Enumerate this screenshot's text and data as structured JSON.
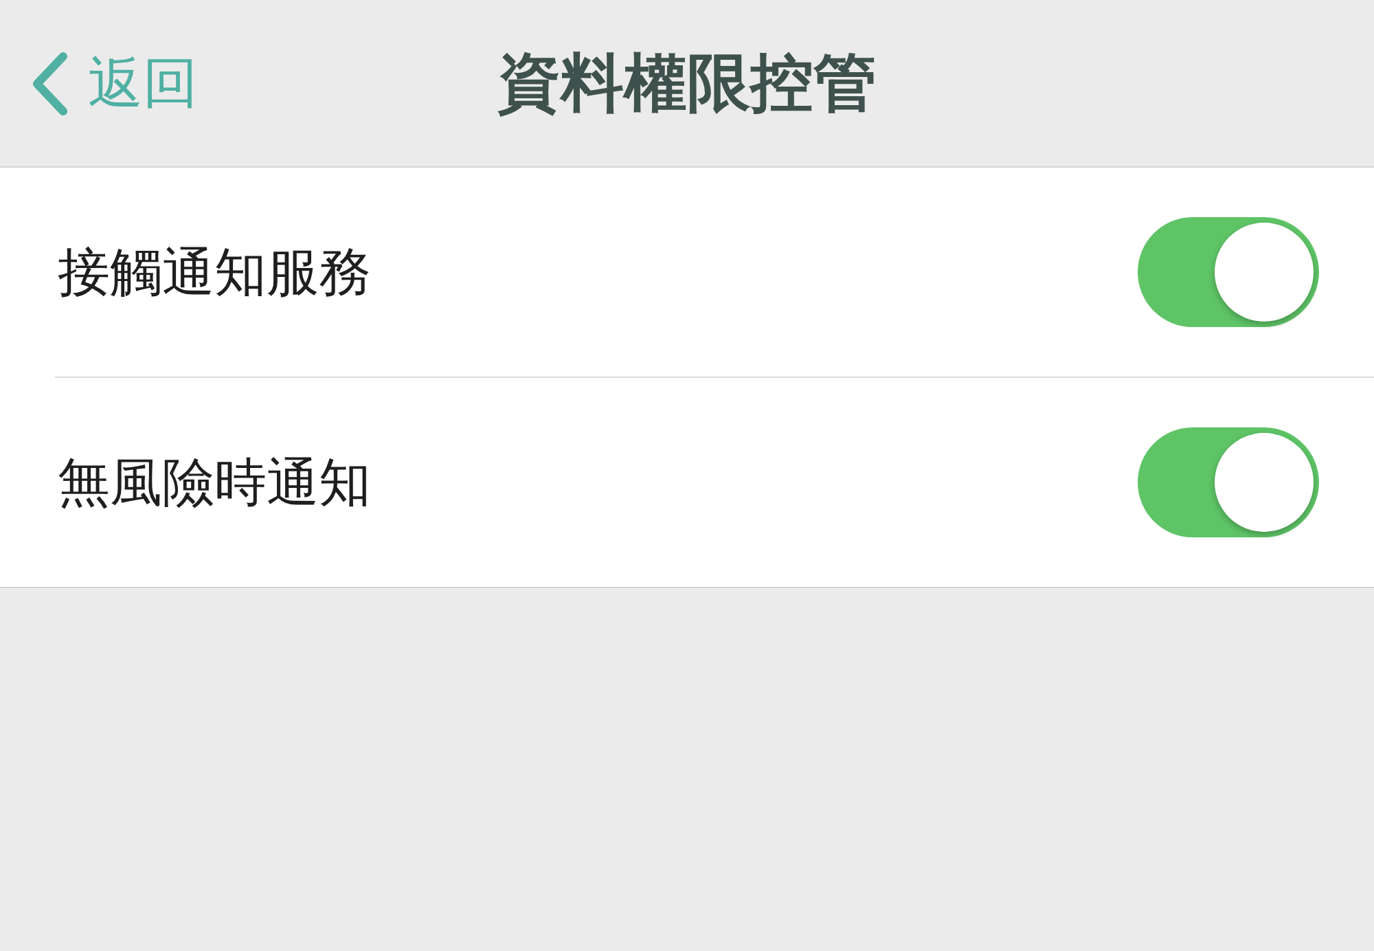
{
  "nav": {
    "back": "返回",
    "title": "資料權限控管"
  },
  "settings": [
    {
      "label": "接觸通知服務",
      "on": true
    },
    {
      "label": "無風險時通知",
      "on": true
    }
  ]
}
